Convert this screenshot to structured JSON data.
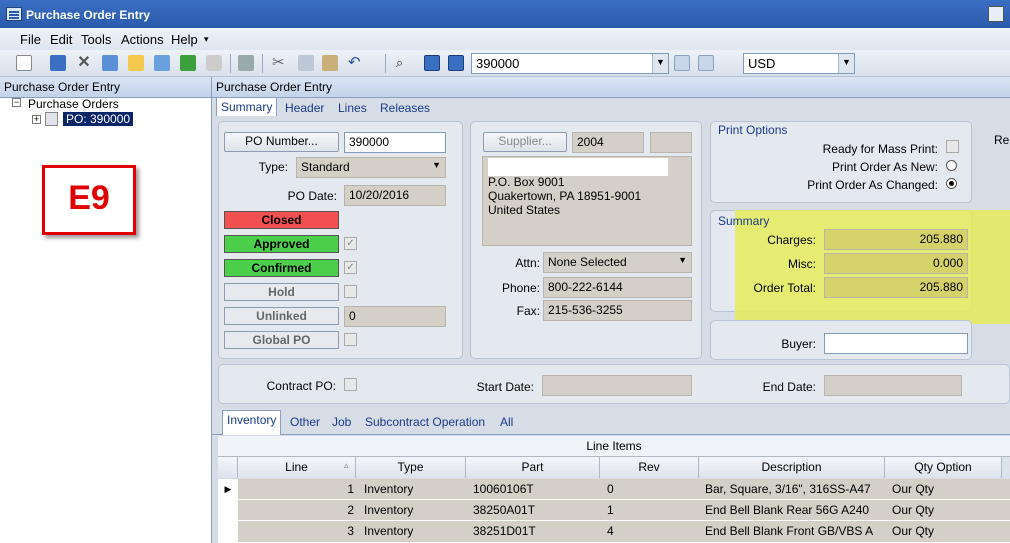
{
  "window": {
    "title": "Purchase Order Entry"
  },
  "menu": [
    "File",
    "Edit",
    "Tools",
    "Actions",
    "Help"
  ],
  "toolbar": {
    "po_combo": "390000",
    "currency_combo": "USD"
  },
  "left": {
    "header": "Purchase Order Entry",
    "tree_root": "Purchase Orders",
    "tree_child": "PO: 390000",
    "annotation": "E9"
  },
  "right": {
    "header": "Purchase Order Entry",
    "tabs": [
      "Summary",
      "Header",
      "Lines",
      "Releases"
    ]
  },
  "po": {
    "po_number_btn": "PO Number...",
    "po_number": "390000",
    "type_label": "Type:",
    "type_value": "Standard",
    "po_date_label": "PO Date:",
    "po_date": "10/20/2016",
    "status": {
      "closed": "Closed",
      "approved": "Approved",
      "confirmed": "Confirmed",
      "hold": "Hold",
      "unlinked": "Unlinked",
      "global": "Global PO"
    },
    "unlinked_value": "0"
  },
  "supplier": {
    "btn": "Supplier...",
    "id": "2004",
    "address": [
      "P.O. Box 9001",
      "Quakertown, PA  18951-9001",
      "United States"
    ],
    "attn_label": "Attn:",
    "attn_value": "None Selected",
    "phone_label": "Phone:",
    "phone": "800-222-6144",
    "fax_label": "Fax:",
    "fax": "215-536-3255"
  },
  "print_options": {
    "title": "Print Options",
    "mass": "Ready for Mass Print:",
    "new": "Print Order As New:",
    "changed": "Print Order As Changed:"
  },
  "summary": {
    "title": "Summary",
    "charges_label": "Charges:",
    "charges": "205.880",
    "misc_label": "Misc:",
    "misc": "0.000",
    "total_label": "Order Total:",
    "total": "205.880"
  },
  "buyer_label": "Buyer:",
  "edge_text": "Re",
  "contract": {
    "contract_label": "Contract PO:",
    "start_label": "Start Date:",
    "end_label": "End Date:"
  },
  "lower_tabs": [
    "Inventory",
    "Other",
    "Job",
    "Subcontract Operation",
    "All"
  ],
  "grid": {
    "title": "Line Items",
    "columns": [
      "Line",
      "Type",
      "Part",
      "Rev",
      "Description",
      "Qty Option"
    ],
    "rows": [
      [
        "1",
        "Inventory",
        "10060106T",
        "0",
        "Bar, Square, 3/16\", 316SS-A47",
        "Our Qty"
      ],
      [
        "2",
        "Inventory",
        "38250A01T",
        "1",
        "End Bell Blank Rear 56G A240",
        "Our Qty"
      ],
      [
        "3",
        "Inventory",
        "38251D01T",
        "4",
        "End Bell Blank Front GB/VBS A",
        "Our Qty"
      ]
    ]
  },
  "colors": {
    "closed": "#f05050",
    "approved": "#4cd04c",
    "highlight": "#e6ec5a"
  }
}
